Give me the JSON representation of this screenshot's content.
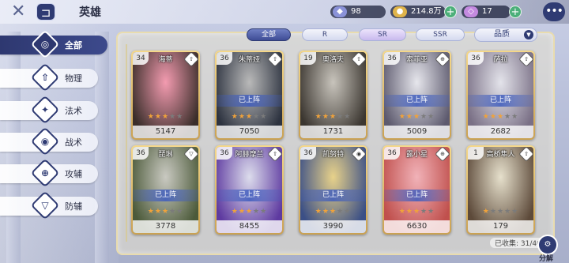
{
  "header": {
    "title": "英雄",
    "back_glyph": "⊐",
    "resources": [
      {
        "name": "crystal",
        "value": "98",
        "color": "#8a92d8"
      },
      {
        "name": "gold",
        "value": "214.8万",
        "color": "#e0b44a"
      },
      {
        "name": "gem",
        "value": "17",
        "color": "#c48ae0"
      }
    ],
    "chat_glyph": "•••"
  },
  "sidebar": {
    "items": [
      {
        "label": "全部",
        "icon": "all-icon",
        "glyph": "◎",
        "active": true
      },
      {
        "label": "物理",
        "icon": "physical-icon",
        "glyph": "⇧",
        "active": false
      },
      {
        "label": "法术",
        "icon": "magic-icon",
        "glyph": "✦",
        "active": false
      },
      {
        "label": "战术",
        "icon": "tactics-icon",
        "glyph": "◉",
        "active": false
      },
      {
        "label": "攻辅",
        "icon": "attack-support-icon",
        "glyph": "⊕",
        "active": false
      },
      {
        "label": "防辅",
        "icon": "defense-support-icon",
        "glyph": "▽",
        "active": false
      }
    ]
  },
  "filters": {
    "tabs": [
      {
        "label": "全部",
        "active": true
      },
      {
        "label": "R",
        "active": false
      },
      {
        "label": "SR",
        "active": false
      },
      {
        "label": "SSR",
        "active": false
      }
    ],
    "sort_label": "品质",
    "sort_arrow": "▼"
  },
  "heroes": [
    {
      "name": "海蒂",
      "level": "34",
      "class_glyph": "⇧",
      "deployed": "",
      "stars": 3,
      "power": "5147",
      "c1": "#f39bb0",
      "c2": "#3a2e2a"
    },
    {
      "name": "朱蒂娅",
      "level": "36",
      "class_glyph": "⇧",
      "deployed": "已上阵",
      "stars": 3,
      "power": "7050",
      "c1": "#b9b9b9",
      "c2": "#2d3340"
    },
    {
      "name": "奥洛夫",
      "level": "19",
      "class_glyph": "⇧",
      "deployed": "",
      "stars": 3,
      "power": "1731",
      "c1": "#c8c4bc",
      "c2": "#3b3630"
    },
    {
      "name": "索菲亚",
      "level": "36",
      "class_glyph": "⊕",
      "deployed": "已上阵",
      "stars": 3,
      "power": "5009",
      "c1": "#e6e6ec",
      "c2": "#5d5a6e"
    },
    {
      "name": "萨拉",
      "level": "36",
      "class_glyph": "⇧",
      "deployed": "已上阵",
      "stars": 3,
      "power": "2682",
      "c1": "#e3e3ea",
      "c2": "#7a7086"
    },
    {
      "name": "琵琳",
      "level": "36",
      "class_glyph": "▽",
      "deployed": "已上阵",
      "stars": 3,
      "power": "3778",
      "c1": "#c9c9c1",
      "c2": "#4c5a3a"
    },
    {
      "name": "阿赫摩兰",
      "level": "36",
      "class_glyph": "⇧",
      "deployed": "已上阵",
      "stars": 3,
      "power": "8455",
      "c1": "#dcdcec",
      "c2": "#5e3aa0"
    },
    {
      "name": "凯努特",
      "level": "36",
      "class_glyph": "◉",
      "deployed": "已上阵",
      "stars": 3,
      "power": "3990",
      "c1": "#e8d28a",
      "c2": "#3b4f86"
    },
    {
      "name": "露小星",
      "level": "36",
      "class_glyph": "⊕",
      "deployed": "已上阵",
      "stars": 3,
      "power": "6630",
      "c1": "#f1b2b8",
      "c2": "#c0504d"
    },
    {
      "name": "高桥隼人",
      "level": "1",
      "class_glyph": "⇧",
      "deployed": "",
      "stars": 1,
      "power": "179",
      "c1": "#e6e0cc",
      "c2": "#5d4a3a"
    }
  ],
  "footer": {
    "count_text": "已收集: 31/40",
    "break_glyph": "⚙",
    "break_label": "分解"
  }
}
